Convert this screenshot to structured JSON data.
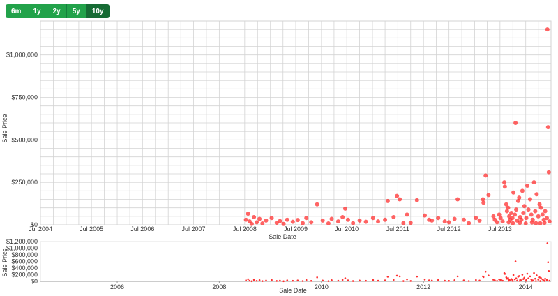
{
  "controls": {
    "ranges": [
      "6m",
      "1y",
      "2y",
      "5y",
      "10y"
    ],
    "active_range": "10y"
  },
  "colors": {
    "grid": "#d3d3d3",
    "point": "#ff3030",
    "button": "#22a24a",
    "button_active": "#166b34"
  },
  "chart_data": [
    {
      "type": "scatter",
      "xlabel": "Sale Date",
      "ylabel": "Sale Price",
      "xlim": [
        "2004-07-01",
        "2014-07-01"
      ],
      "ylim": [
        0,
        1200000
      ],
      "grid": true,
      "x_tick_labels": [
        "Jul 2004",
        "Jul 2005",
        "Jul 2006",
        "Jul 2007",
        "Jul 2008",
        "Jul 2009",
        "Jul 2010",
        "Jul 2011",
        "Jul 2012",
        "Jul 2013"
      ],
      "y_tick_labels": [
        "$0",
        "$250,000",
        "$500,000",
        "$750,000",
        "$1,000,000"
      ],
      "y_ticks": [
        0,
        250000,
        500000,
        750000,
        1000000
      ],
      "points": [
        [
          "2008-07-10",
          30000
        ],
        [
          "2008-07-25",
          65000
        ],
        [
          "2008-08-05",
          20000
        ],
        [
          "2008-08-20",
          5000
        ],
        [
          "2008-09-05",
          45000
        ],
        [
          "2008-09-25",
          15000
        ],
        [
          "2008-10-15",
          35000
        ],
        [
          "2008-11-05",
          8000
        ],
        [
          "2008-12-01",
          25000
        ],
        [
          "2009-01-10",
          40000
        ],
        [
          "2009-02-15",
          12000
        ],
        [
          "2009-03-10",
          22000
        ],
        [
          "2009-04-05",
          5000
        ],
        [
          "2009-05-01",
          30000
        ],
        [
          "2009-06-10",
          18000
        ],
        [
          "2009-07-15",
          28000
        ],
        [
          "2009-08-20",
          10000
        ],
        [
          "2009-09-15",
          40000
        ],
        [
          "2009-10-20",
          15000
        ],
        [
          "2009-12-01",
          120000
        ],
        [
          "2010-01-10",
          25000
        ],
        [
          "2010-02-20",
          8000
        ],
        [
          "2010-03-15",
          35000
        ],
        [
          "2010-05-01",
          20000
        ],
        [
          "2010-06-01",
          45000
        ],
        [
          "2010-06-20",
          95000
        ],
        [
          "2010-07-10",
          30000
        ],
        [
          "2010-08-15",
          10000
        ],
        [
          "2010-10-01",
          25000
        ],
        [
          "2010-11-15",
          18000
        ],
        [
          "2011-01-05",
          40000
        ],
        [
          "2011-02-10",
          20000
        ],
        [
          "2011-04-01",
          30000
        ],
        [
          "2011-04-20",
          140000
        ],
        [
          "2011-06-01",
          45000
        ],
        [
          "2011-06-25",
          170000
        ],
        [
          "2011-07-15",
          150000
        ],
        [
          "2011-08-10",
          10000
        ],
        [
          "2011-09-05",
          60000
        ],
        [
          "2011-10-01",
          12000
        ],
        [
          "2011-11-15",
          145000
        ],
        [
          "2012-01-10",
          55000
        ],
        [
          "2012-02-10",
          30000
        ],
        [
          "2012-03-01",
          25000
        ],
        [
          "2012-04-15",
          40000
        ],
        [
          "2012-06-01",
          20000
        ],
        [
          "2012-07-01",
          15000
        ],
        [
          "2012-08-10",
          35000
        ],
        [
          "2012-09-01",
          150000
        ],
        [
          "2012-10-15",
          30000
        ],
        [
          "2012-11-20",
          10000
        ],
        [
          "2013-01-10",
          40000
        ],
        [
          "2013-02-05",
          25000
        ],
        [
          "2013-03-01",
          150000
        ],
        [
          "2013-03-05",
          130000
        ],
        [
          "2013-03-20",
          290000
        ],
        [
          "2013-04-10",
          175000
        ],
        [
          "2013-05-15",
          50000
        ],
        [
          "2013-05-25",
          30000
        ],
        [
          "2013-06-10",
          15000
        ],
        [
          "2013-06-25",
          60000
        ],
        [
          "2013-07-05",
          40000
        ],
        [
          "2013-07-20",
          20000
        ],
        [
          "2013-08-01",
          250000
        ],
        [
          "2013-08-05",
          225000
        ],
        [
          "2013-08-15",
          120000
        ],
        [
          "2013-08-20",
          80000
        ],
        [
          "2013-08-28",
          100000
        ],
        [
          "2013-09-05",
          50000
        ],
        [
          "2013-09-12",
          30000
        ],
        [
          "2013-09-20",
          70000
        ],
        [
          "2013-09-28",
          40000
        ],
        [
          "2013-10-05",
          190000
        ],
        [
          "2013-10-15",
          60000
        ],
        [
          "2013-10-20",
          600000
        ],
        [
          "2013-10-25",
          90000
        ],
        [
          "2013-11-01",
          25000
        ],
        [
          "2013-11-08",
          140000
        ],
        [
          "2013-11-15",
          160000
        ],
        [
          "2013-11-22",
          45000
        ],
        [
          "2013-12-01",
          30000
        ],
        [
          "2013-12-08",
          200000
        ],
        [
          "2013-12-15",
          70000
        ],
        [
          "2013-12-22",
          110000
        ],
        [
          "2014-01-05",
          40000
        ],
        [
          "2014-01-12",
          230000
        ],
        [
          "2014-01-20",
          90000
        ],
        [
          "2014-02-01",
          150000
        ],
        [
          "2014-02-10",
          60000
        ],
        [
          "2014-02-20",
          30000
        ],
        [
          "2014-03-01",
          250000
        ],
        [
          "2014-03-10",
          80000
        ],
        [
          "2014-03-20",
          180000
        ],
        [
          "2014-04-01",
          50000
        ],
        [
          "2014-04-10",
          120000
        ],
        [
          "2014-04-20",
          100000
        ],
        [
          "2014-05-01",
          60000
        ],
        [
          "2014-05-10",
          30000
        ],
        [
          "2014-05-20",
          80000
        ],
        [
          "2014-06-01",
          40000
        ],
        [
          "2014-06-05",
          1150000
        ],
        [
          "2014-06-10",
          575000
        ],
        [
          "2014-06-15",
          310000
        ],
        [
          "2014-06-20",
          20000
        ],
        [
          "2013-09-01",
          15000
        ],
        [
          "2013-10-01",
          10000
        ],
        [
          "2013-11-20",
          12000
        ],
        [
          "2014-01-01",
          8000
        ],
        [
          "2014-02-15",
          14000
        ],
        [
          "2014-03-15",
          10000
        ],
        [
          "2014-04-15",
          9000
        ],
        [
          "2014-05-15",
          12000
        ]
      ]
    },
    {
      "type": "scatter",
      "role": "overview",
      "xlabel": "Sale Date",
      "ylabel": "Sale Price",
      "xlim": [
        "2004-07-01",
        "2014-07-01"
      ],
      "ylim": [
        0,
        1200000
      ],
      "x_tick_labels": [
        "2006",
        "2008",
        "2010",
        "2012",
        "2014"
      ],
      "y_tick_labels": [
        "$0",
        "$200,000",
        "$400,000",
        "$600,000",
        "$800,000",
        "$1,000,000",
        "$1,200,000"
      ],
      "y_ticks": [
        0,
        200000,
        400000,
        600000,
        800000,
        1000000,
        1200000
      ]
    }
  ]
}
